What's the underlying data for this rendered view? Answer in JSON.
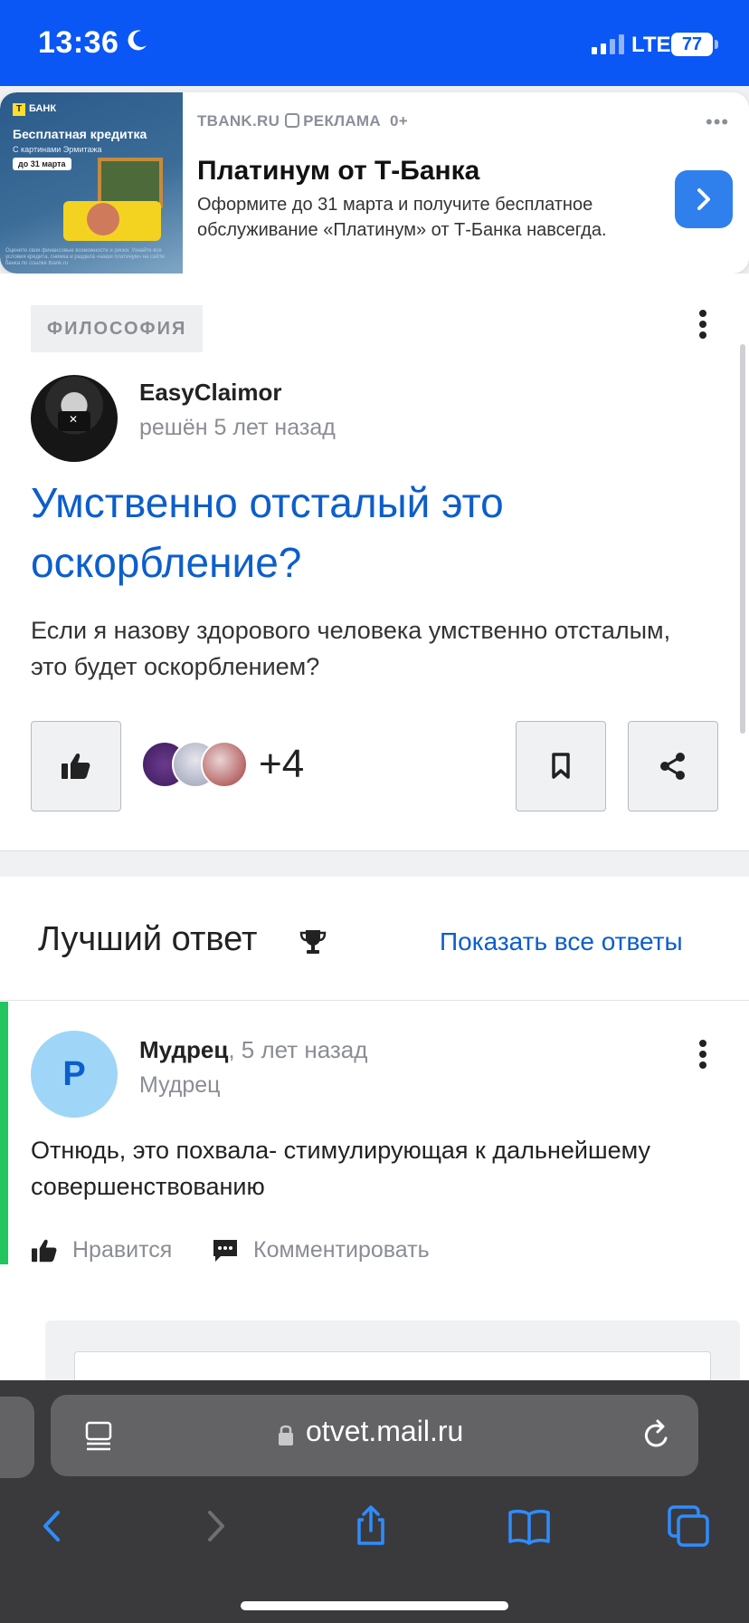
{
  "status_bar": {
    "time": "13:36",
    "network": "LTE",
    "battery": "77"
  },
  "ad": {
    "source": "TBANK.RU",
    "label": "РЕКЛАМА",
    "age": "0+",
    "headline": "Платинум от Т-Банка",
    "description": "Оформите до 31 марта и получите бесплатное обслуживание «Платинум» от Т-Банка навсегда.",
    "image": {
      "bank": "БАНК",
      "bank_logo": "Т",
      "title": "Бесплатная кредитка",
      "subtitle": "С картинами Эрмитажа",
      "chip": "до 31 марта",
      "fine_print": "Оцените свои финансовые возможности и риски. Узнайте все условия кредита, снимка и раздела «наши платинум» на сайте банка по ссылке tbank.ru"
    }
  },
  "question": {
    "category": "ФИЛОСОФИЯ",
    "author": "EasyClaimor",
    "status": "решён 5 лет назад",
    "title": "Умственно отсталый это оскорбление?",
    "body": "Если я назову здорового человека умственно отсталым, это будет оскорблением?",
    "likes_more": "+4"
  },
  "best_answer": {
    "section_title": "Лучший ответ",
    "show_all": "Показать все ответы",
    "avatar_letter": "Р",
    "author": "Мудрец",
    "time": ", 5 лет назад",
    "rank": "Мудрец",
    "text": "Отнюдь, это похвала- стимулирующая к дальнейшему совершенствованию",
    "like_label": "Нравится",
    "comment_label": "Комментировать"
  },
  "browser": {
    "url": "otvet.mail.ru"
  },
  "colors": {
    "status_bar": "#0a57f5",
    "link": "#0c5ecc",
    "best_answer_accent": "#22c55e",
    "ad_button": "#2f80ed"
  }
}
